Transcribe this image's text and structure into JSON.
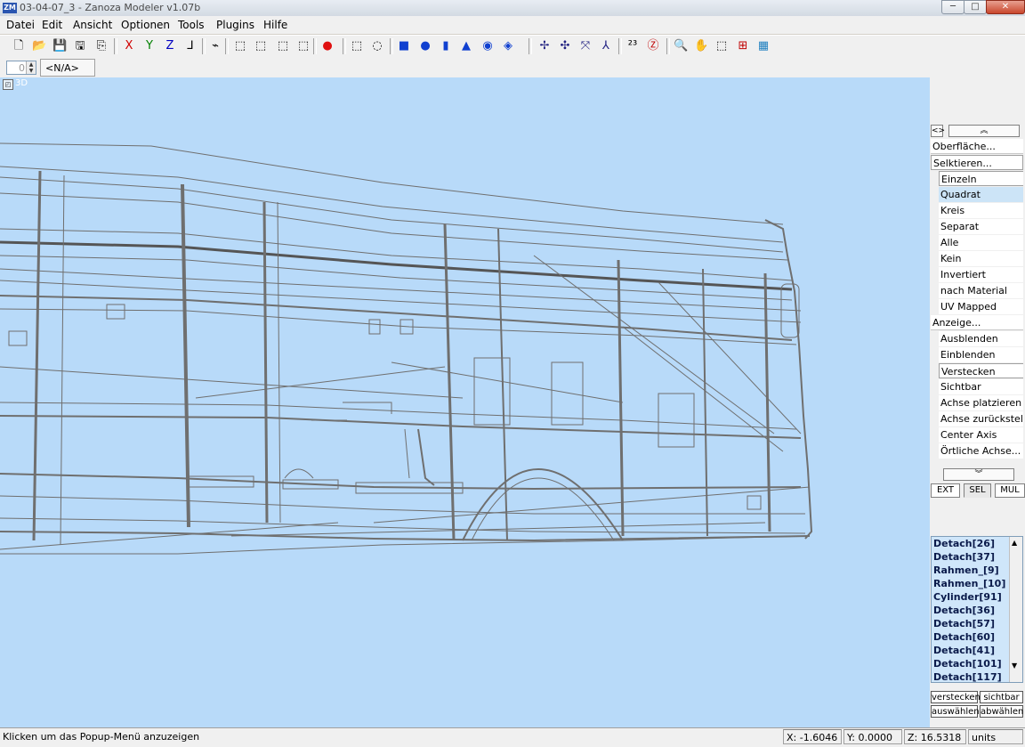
{
  "window": {
    "title": "03-04-07_3 - Zanoza Modeler v1.07b",
    "icon_text": "ZM",
    "minimize": "─",
    "maximize": "□",
    "close": "✕"
  },
  "menu": [
    "Datei",
    "Edit",
    "Ansicht",
    "Optionen",
    "Tools",
    "Plugins",
    "Hilfe"
  ],
  "toolbar": {
    "icons": [
      {
        "name": "new-file-icon",
        "glyph": "🗋"
      },
      {
        "name": "open-file-icon",
        "glyph": "📂"
      },
      {
        "name": "save-icon",
        "glyph": "💾"
      },
      {
        "name": "save-as-icon",
        "glyph": "🖫"
      },
      {
        "name": "export-icon",
        "glyph": "⎘"
      },
      {
        "name": "axis-x-icon",
        "glyph": "X",
        "color": "#d00000"
      },
      {
        "name": "axis-y-icon",
        "glyph": "Y",
        "color": "#008000"
      },
      {
        "name": "axis-z-icon",
        "glyph": "Z",
        "color": "#0000c0"
      },
      {
        "name": "axis-lock-icon",
        "glyph": "⅃"
      },
      {
        "name": "vertex-icon",
        "glyph": "⌁"
      },
      {
        "name": "wire-cube-icon",
        "glyph": "⬚"
      },
      {
        "name": "cube-icon",
        "glyph": "⬚"
      },
      {
        "name": "cube-red-icon",
        "glyph": "⬚"
      },
      {
        "name": "cube-red-active-icon",
        "glyph": "⬚"
      },
      {
        "name": "sphere-red-icon",
        "glyph": "●",
        "color": "#e01010"
      },
      {
        "name": "select-box-icon",
        "glyph": "⬚"
      },
      {
        "name": "select-circle-icon",
        "glyph": "◌"
      },
      {
        "name": "box-primitive-icon",
        "glyph": "■",
        "color": "#1040d0"
      },
      {
        "name": "sphere-primitive-icon",
        "glyph": "●",
        "color": "#1040d0"
      },
      {
        "name": "cylinder-primitive-icon",
        "glyph": "▮",
        "color": "#1040d0"
      },
      {
        "name": "cone-primitive-icon",
        "glyph": "▲",
        "color": "#1040d0"
      },
      {
        "name": "torus-primitive-icon",
        "glyph": "◉",
        "color": "#1040d0"
      },
      {
        "name": "plane-primitive-icon",
        "glyph": "◈",
        "color": "#1040d0"
      },
      {
        "name": "move-icon",
        "glyph": "✢",
        "color": "#202080"
      },
      {
        "name": "rotate-icon",
        "glyph": "✣",
        "color": "#202080"
      },
      {
        "name": "scale-icon",
        "glyph": "⤧",
        "color": "#202080"
      },
      {
        "name": "axis-gizmo-icon",
        "glyph": "⅄",
        "color": "#202080"
      },
      {
        "name": "view-2d3d-icon",
        "glyph": "²³"
      },
      {
        "name": "z-view-icon",
        "glyph": "Ⓩ",
        "color": "#c00000"
      },
      {
        "name": "zoom-icon",
        "glyph": "🔍"
      },
      {
        "name": "pan-hand-icon",
        "glyph": "✋"
      },
      {
        "name": "view-cube-icon",
        "glyph": "⬚"
      },
      {
        "name": "render-icon",
        "glyph": "⊞",
        "color": "#c00000"
      },
      {
        "name": "texture-icon",
        "glyph": "▦",
        "color": "#2080c0"
      }
    ]
  },
  "stats": {
    "spinner_value": "0",
    "na_label": "<N/A>"
  },
  "viewport": {
    "label": "3D"
  },
  "sidepanel": {
    "scroll_up": "︽",
    "scroll_down": "︾",
    "diamond": "<>",
    "sections": {
      "surface": "Oberfläche...",
      "select": "Selktieren...",
      "display": "Anzeige..."
    },
    "select_options": [
      "Einzeln",
      "Quadrat",
      "Kreis",
      "Separat",
      "Alle",
      "Kein",
      "Invertiert",
      "nach Material",
      "UV Mapped"
    ],
    "display_options": [
      "Ausblenden",
      "Einblenden",
      "Verstecken",
      "Sichtbar",
      "Achse platzieren",
      "Achse zurückstellen",
      "Center Axis",
      "Örtliche Achse..."
    ],
    "mode_tabs": [
      "EXT",
      "SEL",
      "MUL"
    ],
    "objects": [
      "Detach[26]",
      "Detach[37]",
      "Rahmen_[9]",
      "Rahmen_[10]",
      "Cylinder[91]",
      "Detach[36]",
      "Detach[57]",
      "Detach[60]",
      "Detach[41]",
      "Detach[101]",
      "Detach[117]"
    ],
    "buttons": {
      "hide": "verstecken",
      "show": "sichtbar",
      "select": "auswählen",
      "deselect": "abwählen"
    }
  },
  "status": {
    "message": "Klicken um das Popup-Menü anzuzeigen",
    "x": "X: -1.6046",
    "y": "Y: 0.0000",
    "z": "Z: 16.5318",
    "units": "units"
  }
}
